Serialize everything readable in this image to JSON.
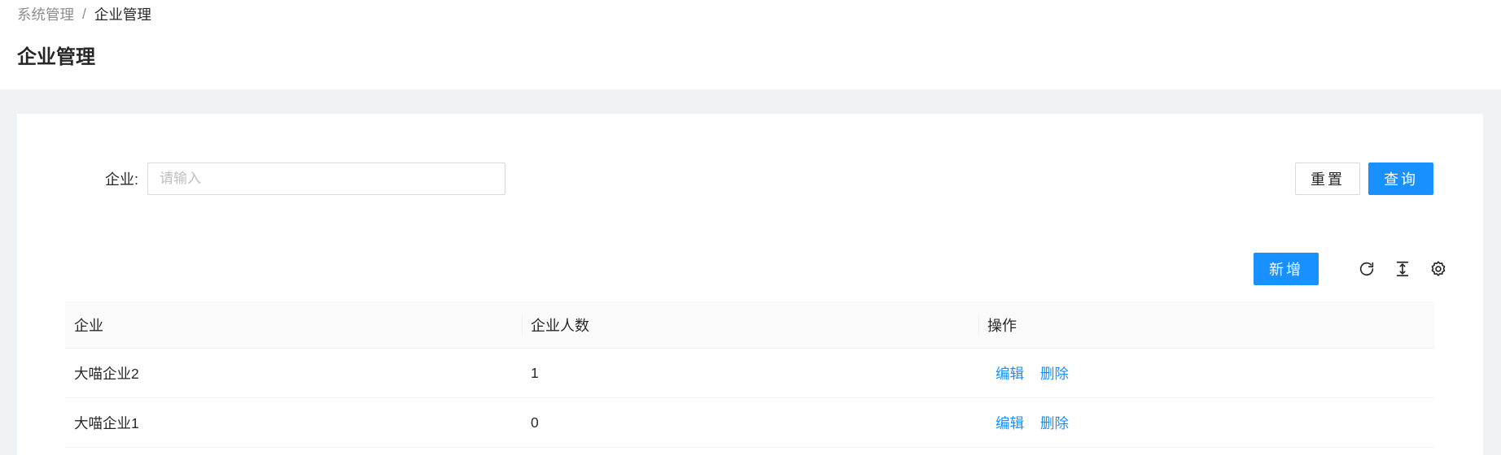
{
  "breadcrumb": {
    "items": [
      "系统管理",
      "企业管理"
    ],
    "separator": "/"
  },
  "page": {
    "title": "企业管理"
  },
  "search": {
    "label": "企业:",
    "placeholder": "请输入",
    "value": "",
    "reset_label": "重置",
    "query_label": "查询"
  },
  "toolbar": {
    "add_label": "新增",
    "icons": [
      "reload-icon",
      "column-height-icon",
      "setting-icon"
    ]
  },
  "table": {
    "columns": [
      "企业",
      "企业人数",
      "操作"
    ],
    "rows": [
      {
        "company": "大喵企业2",
        "count": "1",
        "edit": "编辑",
        "delete": "删除"
      },
      {
        "company": "大喵企业1",
        "count": "0",
        "edit": "编辑",
        "delete": "删除"
      }
    ]
  },
  "colors": {
    "primary": "#1890ff",
    "page_bg": "#f0f2f5",
    "card_bg": "#ffffff",
    "table_header_bg": "#fafafa"
  }
}
